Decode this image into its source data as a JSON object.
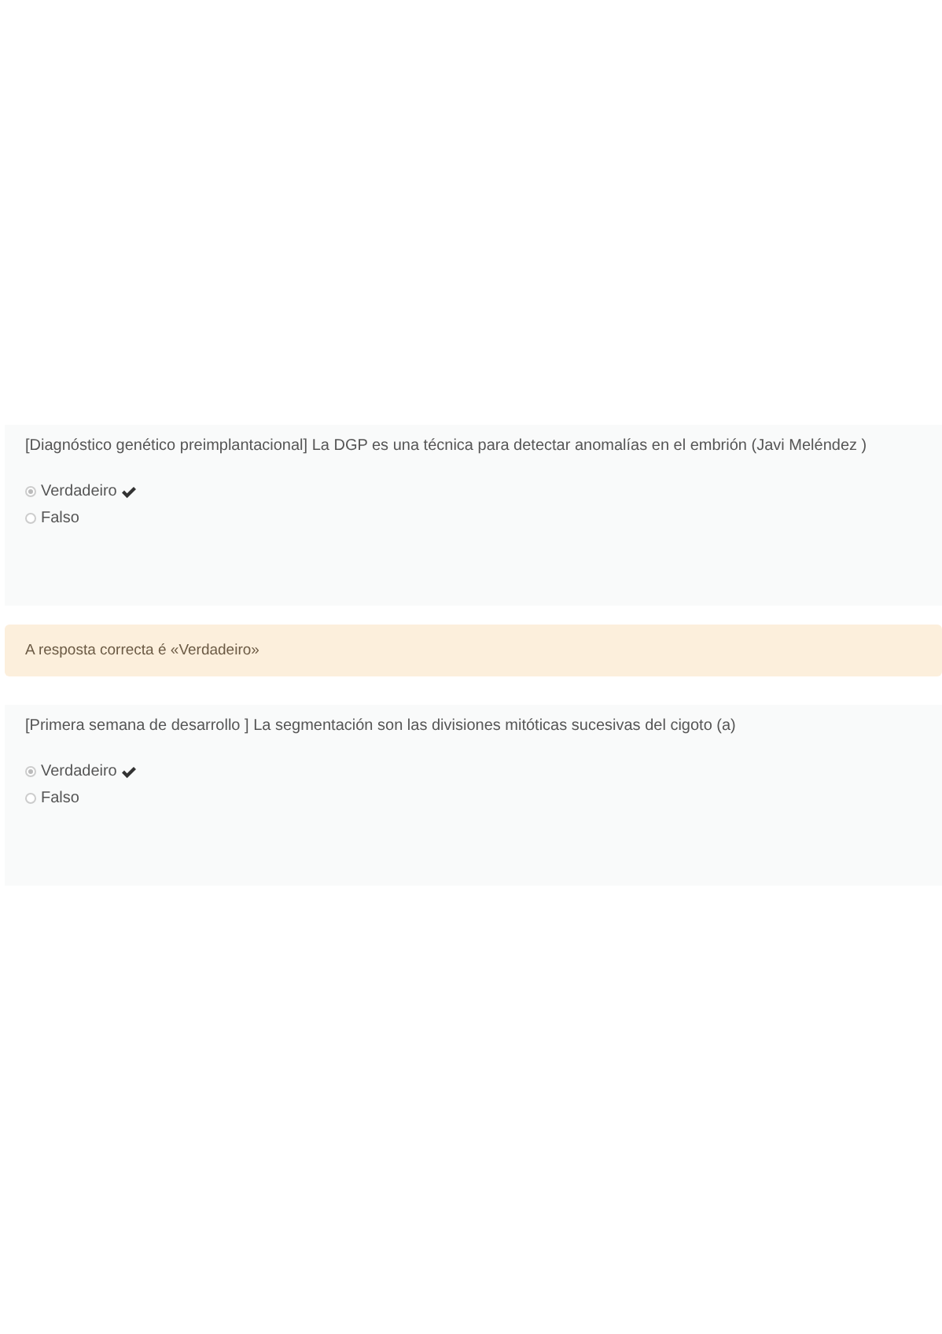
{
  "questions": [
    {
      "text": "[Diagnóstico genético preimplantacional] La DGP es una técnica para detectar anomalías en el embrión (Javi Meléndez )",
      "options": [
        {
          "label": "Verdadeiro",
          "selected": true,
          "correct": true
        },
        {
          "label": "Falso",
          "selected": false,
          "correct": false
        }
      ],
      "feedback": "A resposta correcta é «Verdadeiro»"
    },
    {
      "text": "[Primera semana de desarrollo ] La segmentación son las divisiones mitóticas sucesivas del cigoto (a)",
      "options": [
        {
          "label": "Verdadeiro",
          "selected": true,
          "correct": true
        },
        {
          "label": "Falso",
          "selected": false,
          "correct": false
        }
      ]
    }
  ]
}
